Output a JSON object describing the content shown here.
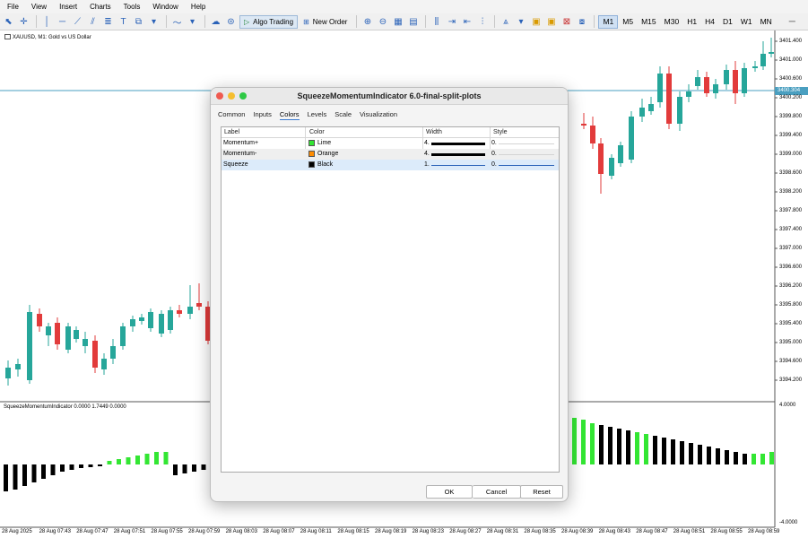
{
  "menu": [
    "File",
    "View",
    "Insert",
    "Charts",
    "Tools",
    "Window",
    "Help"
  ],
  "toolbar": {
    "algo_trading": "Algo Trading",
    "new_order": "New Order",
    "timeframes": [
      "M1",
      "M5",
      "M15",
      "M30",
      "H1",
      "H4",
      "D1",
      "W1",
      "MN"
    ],
    "active_timeframe": "M1"
  },
  "chart": {
    "title": "XAUUSD, M1: Gold vs US Dollar",
    "indicator_title": "SqueezeMomentumIndicator 0.0000 1.7449 0.0000",
    "current_price": "3400.304",
    "price_labels": [
      "3401.400",
      "3401.000",
      "3400.600",
      "3400.200",
      "3399.800",
      "3399.400",
      "3399.000",
      "3398.600",
      "3398.200",
      "3397.800",
      "3397.400",
      "3397.000",
      "3396.600",
      "3396.200",
      "3395.800",
      "3395.400",
      "3395.000",
      "3394.600",
      "3394.200"
    ],
    "indicator_labels": [
      "4.0000",
      "-4.0000"
    ],
    "time_labels": [
      "28 Aug 2025",
      "28 Aug 07:43",
      "28 Aug 07:47",
      "28 Aug 07:51",
      "28 Aug 07:55",
      "28 Aug 07:59",
      "28 Aug 08:03",
      "28 Aug 08:07",
      "28 Aug 08:11",
      "28 Aug 08:15",
      "28 Aug 08:19",
      "28 Aug 08:23",
      "28 Aug 08:27",
      "28 Aug 08:31",
      "28 Aug 08:35",
      "28 Aug 08:39",
      "28 Aug 08:43",
      "28 Aug 08:47",
      "28 Aug 08:51",
      "28 Aug 08:55",
      "28 Aug 08:59"
    ],
    "colors": {
      "bull": "#26a69a",
      "bear": "#e23b3b",
      "lime": "#33e633",
      "black": "#000000",
      "hline": "#4a9fc0"
    }
  },
  "dialog": {
    "title": "SqueezeMomentumIndicator 6.0-final-split-plots",
    "tabs": [
      "Common",
      "Inputs",
      "Colors",
      "Levels",
      "Scale",
      "Visualization"
    ],
    "active_tab": "Colors",
    "columns": {
      "label": "Label",
      "color": "Color",
      "width": "Width",
      "style": "Style"
    },
    "rows": [
      {
        "label": "Momentum+",
        "color_name": "Lime",
        "swatch": "#33e633",
        "width": "4.",
        "style": "0."
      },
      {
        "label": "Momentum-",
        "color_name": "Orange",
        "swatch": "#ff8c00",
        "width": "4.",
        "style": "0."
      },
      {
        "label": "Squeeze",
        "color_name": "Black",
        "swatch": "#000000",
        "width": "1.",
        "style": "0."
      }
    ],
    "buttons": {
      "ok": "OK",
      "cancel": "Cancel",
      "reset": "Reset"
    }
  }
}
